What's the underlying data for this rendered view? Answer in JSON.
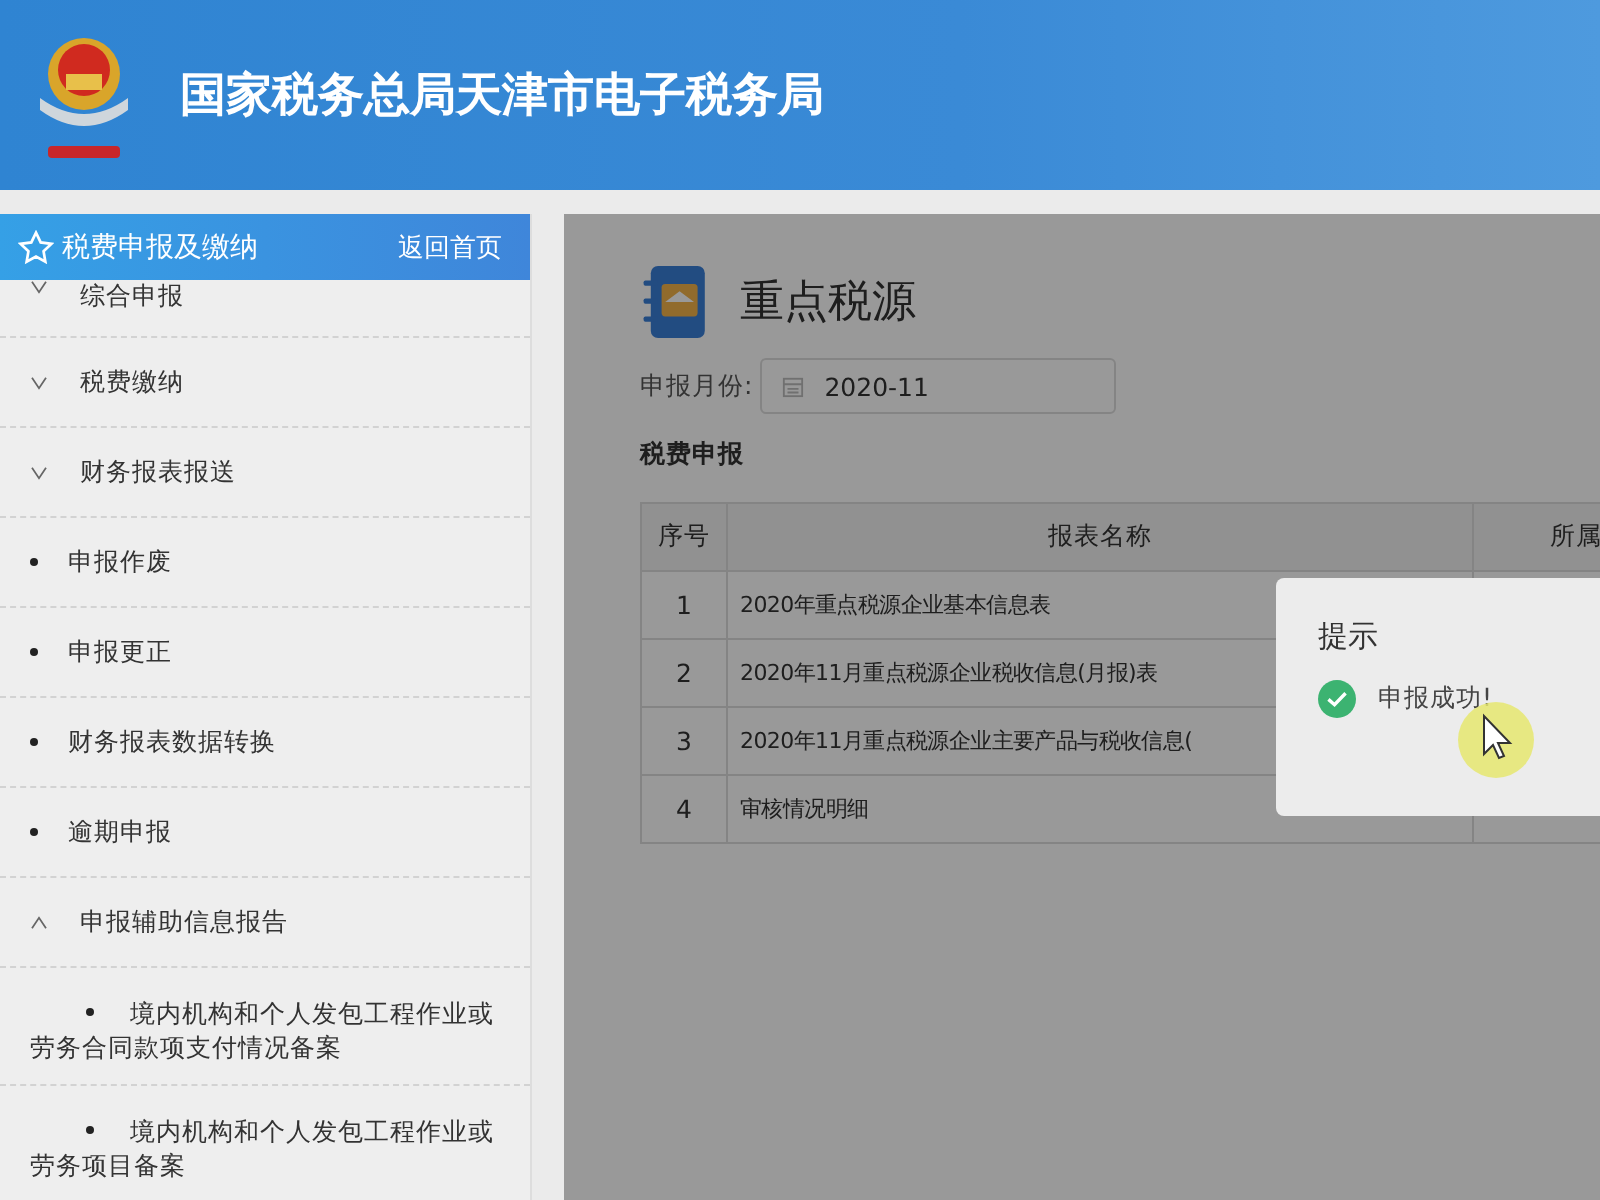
{
  "header": {
    "title": "国家税务总局天津市电子税务局"
  },
  "sidebar": {
    "title": "税费申报及缴纳",
    "home_link": "返回首页",
    "items": [
      {
        "kind": "group",
        "label": "综合申报",
        "expanded": false
      },
      {
        "kind": "group",
        "label": "税费缴纳",
        "expanded": false
      },
      {
        "kind": "group",
        "label": "财务报表报送",
        "expanded": false
      },
      {
        "kind": "link",
        "label": "申报作废"
      },
      {
        "kind": "link",
        "label": "申报更正"
      },
      {
        "kind": "link",
        "label": "财务报表数据转换"
      },
      {
        "kind": "link",
        "label": "逾期申报"
      },
      {
        "kind": "group",
        "label": "申报辅助信息报告",
        "expanded": true,
        "children": [
          {
            "kind": "link",
            "label": "境内机构和个人发包工程作业或劳务合同款项支付情况备案"
          },
          {
            "kind": "link",
            "label": "境内机构和个人发包工程作业或劳务项目备案"
          }
        ]
      }
    ]
  },
  "page": {
    "title": "重点税源",
    "month_label": "申报月份:",
    "month_value": "2020-11",
    "section": "税费申报"
  },
  "table": {
    "columns": [
      "序号",
      "报表名称",
      "所属"
    ],
    "rows": [
      [
        "1",
        "2020年重点税源企业基本信息表"
      ],
      [
        "2",
        "2020年11月重点税源企业税收信息(月报)表"
      ],
      [
        "3",
        "2020年11月重点税源企业主要产品与税收信息("
      ],
      [
        "4",
        "审核情况明细"
      ]
    ]
  },
  "dialog": {
    "title": "提示",
    "message": "申报成功!"
  }
}
